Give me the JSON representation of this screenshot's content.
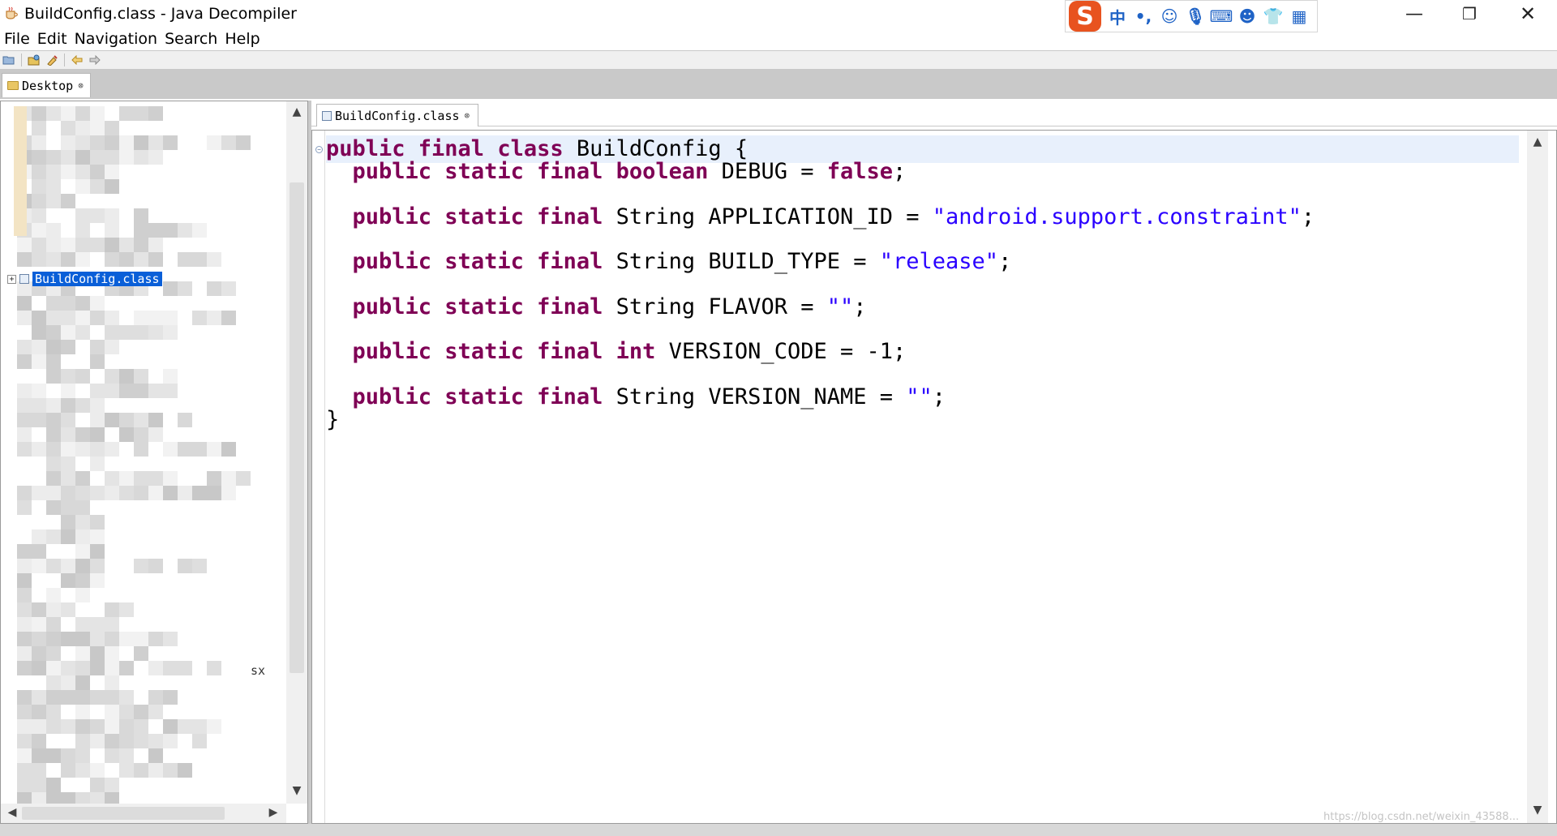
{
  "window": {
    "title": "BuildConfig.class - Java Decompiler",
    "min_glyph": "—",
    "max_glyph": "❐",
    "close_glyph": "✕"
  },
  "ime": {
    "logo": "S",
    "icons": [
      "中",
      "•,",
      "☺",
      "🎙",
      "⌨",
      "☻",
      "👕",
      "▦"
    ]
  },
  "menu": [
    "File",
    "Edit",
    "Navigation",
    "Search",
    "Help"
  ],
  "left_tab": {
    "label": "Desktop",
    "close": "⊗"
  },
  "tree": {
    "selected_expander": "+",
    "selected_label": "BuildConfig.class",
    "partial_text": "sx",
    "arrows": {
      "up": "▲",
      "down": "▼",
      "left": "◀",
      "right": "▶"
    }
  },
  "editor": {
    "tab_label": "BuildConfig.class",
    "tab_close": "⊗",
    "code": {
      "l1": {
        "kw": "public final class",
        "rest": " BuildConfig {"
      },
      "l2": {
        "kw1": "public static final boolean",
        "mid": " DEBUG = ",
        "kw2": "false",
        "end": ";"
      },
      "l3": {
        "kw": "public static final",
        "mid": " String APPLICATION_ID = ",
        "str": "\"android.support.constraint\"",
        "end": ";"
      },
      "l4": {
        "kw": "public static final",
        "mid": " String BUILD_TYPE = ",
        "str": "\"release\"",
        "end": ";"
      },
      "l5": {
        "kw": "public static final",
        "mid": " String FLAVOR = ",
        "str": "\"\"",
        "end": ";"
      },
      "l6": {
        "kw1": "public static final int",
        "mid": " VERSION_CODE = -1;"
      },
      "l7": {
        "kw": "public static final",
        "mid": " String VERSION_NAME = ",
        "str": "\"\"",
        "end": ";"
      },
      "l8": {
        "text": "}"
      }
    }
  },
  "watermark": "https://blog.csdn.net/weixin_43588..."
}
